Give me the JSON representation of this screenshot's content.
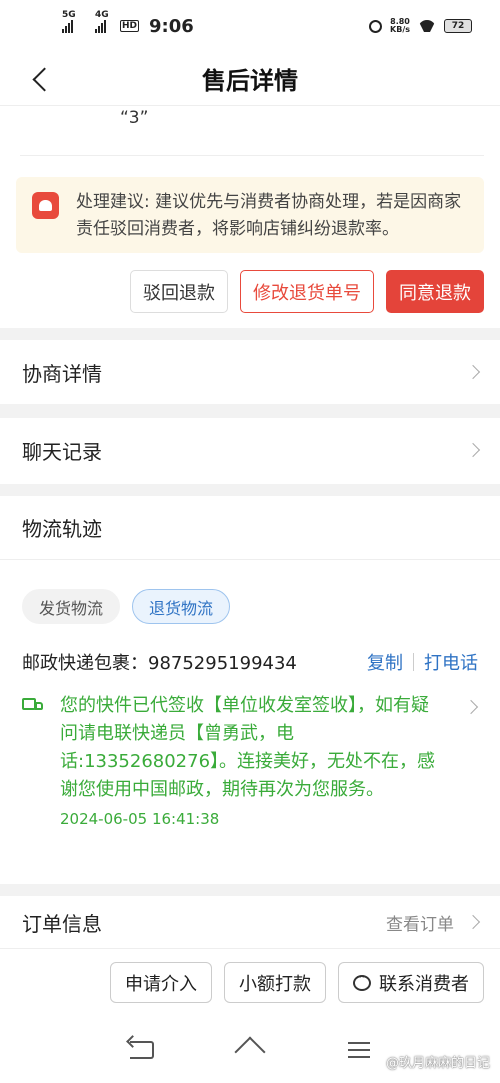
{
  "status_bar": {
    "sig1_label": "5G",
    "sig2_label": "4G",
    "hd_label": "HD",
    "time": "9:06",
    "speed_value": "8.80",
    "speed_unit": "KB/s",
    "battery": "72"
  },
  "header": {
    "title": "售后详情"
  },
  "quote_text": "“3”",
  "advice": {
    "text": "处理建议: 建议优先与消费者协商处理，若是因商家责任驳回消费者，将影响店铺纠纷退款率。"
  },
  "actions": {
    "reject": "驳回退款",
    "modify": "修改退货单号",
    "agree": "同意退款"
  },
  "sections": {
    "negotiation": "协商详情",
    "chat": "聊天记录",
    "logistics": "物流轨迹"
  },
  "logistics": {
    "tabs": [
      "发货物流",
      "退货物流"
    ],
    "active_tab": "退货物流",
    "carrier_label": "邮政快递包裹：9875295199434",
    "copy": "复制",
    "call": "打电话",
    "event_text": "您的快件已代签收【单位收发室签收】，如有疑问请电联快递员【曾勇武，电话:13352680276】。连接美好，无处不在，感谢您使用中国邮政，期待再次为您服务。",
    "event_time": "2024-06-05 16:41:38"
  },
  "order": {
    "label": "订单信息",
    "link": "查看订单"
  },
  "bottom": {
    "intervene": "申请介入",
    "small_pay": "小额打款",
    "contact": "联系消费者"
  },
  "watermark": "@玖月麻麻的日记",
  "colors": {
    "accent_red": "#e4443a",
    "link_blue": "#2f73c4",
    "logistics_green": "#3aab3a"
  }
}
